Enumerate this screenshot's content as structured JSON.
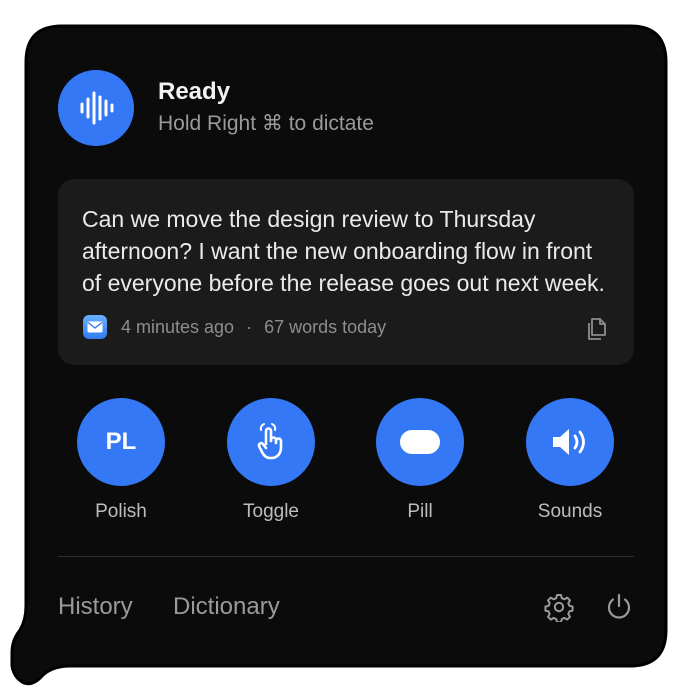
{
  "header": {
    "status_title": "Ready",
    "status_subtitle": "Hold Right ⌘ to dictate",
    "icon": "waveform-icon"
  },
  "last_transcript": {
    "text": "Can we move the design review to Thursday afternoon? I want the new onboarding flow in front of everyone before the release goes out next week.",
    "app_icon": "mail-app-icon",
    "time_ago": "4 minutes ago",
    "separator": "·",
    "word_count": "67 words today",
    "copy_icon": "copy-icon"
  },
  "actions": [
    {
      "id": "polish",
      "label": "Polish",
      "badge": "PL"
    },
    {
      "id": "toggle",
      "label": "Toggle",
      "icon": "hand-pointer-icon"
    },
    {
      "id": "pill",
      "label": "Pill",
      "icon": "pill-shape-icon"
    },
    {
      "id": "sounds",
      "label": "Sounds",
      "icon": "speaker-icon"
    }
  ],
  "footer": {
    "history_label": "History",
    "dictionary_label": "Dictionary",
    "settings_icon": "gear-icon",
    "power_icon": "power-icon"
  },
  "colors": {
    "panel_bg": "#0b0b0b",
    "card_bg": "#1b1b1b",
    "accent": "#3478f6",
    "text_primary": "#f2f2f2",
    "text_secondary": "#9a9a9a"
  }
}
